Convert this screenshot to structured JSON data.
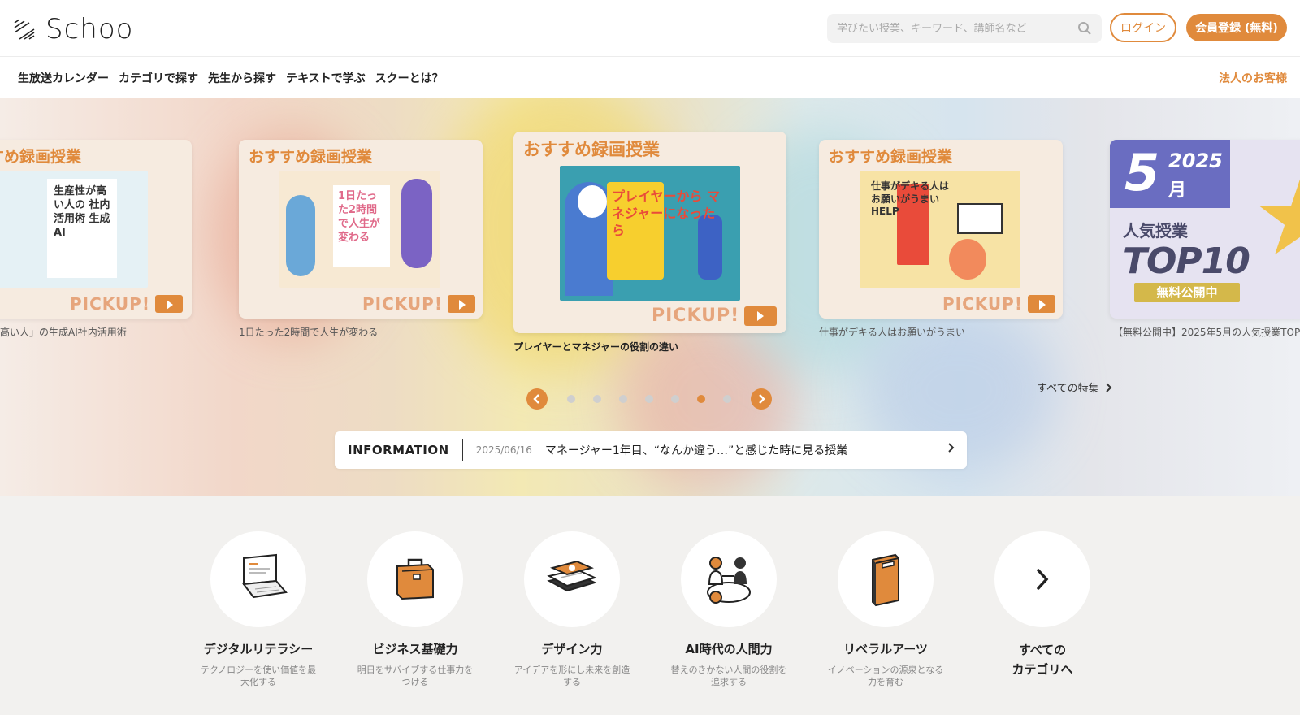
{
  "header": {
    "logo_text": "Schoo",
    "search_placeholder": "学びたい授業、キーワード、講師名など",
    "login_label": "ログイン",
    "register_label": "会員登録 (無料)"
  },
  "nav": {
    "items": [
      {
        "label": "生放送カレンダー"
      },
      {
        "label": "カテゴリで探す"
      },
      {
        "label": "先生から探す"
      },
      {
        "label": "テキストで学ぶ"
      },
      {
        "label": "スクーとは？"
      }
    ],
    "corporate_label": "法人のお客様"
  },
  "carousel": {
    "cards": [
      {
        "heading": "おすすめ録画授業",
        "art_text": "生産性が高い人の 社内活用術 生成AI",
        "pickup": "PICKUP!",
        "caption": "高い人」の生成AI社内活用術"
      },
      {
        "heading": "おすすめ録画授業",
        "art_text": "1日たった2時間で人生が変わる",
        "pickup": "PICKUP!",
        "caption": "1日たった2時間で人生が変わる"
      },
      {
        "heading": "おすすめ録画授業",
        "art_text": "プレイヤーから マネジャーになったら",
        "pickup": "PICKUP!",
        "caption": "プレイヤーとマネジャーの役割の違い"
      },
      {
        "heading": "おすすめ録画授業",
        "art_text": "仕事がデキる人は お願いがうまい HELP",
        "pickup": "PICKUP!",
        "caption": "仕事がデキる人はお願いがうまい"
      },
      {
        "month": "5",
        "month_unit": "月",
        "year": "2025",
        "line1": "人気授業",
        "line2": "TOP10",
        "badge": "無料公開中",
        "caption": "【無料公開中】2025年5月の人気授業TOP"
      }
    ],
    "all_features_label": "すべての特集",
    "dot_count": 7,
    "active_dot": 6,
    "prev_icon": "chevron-left-icon",
    "next_icon": "chevron-right-icon"
  },
  "info": {
    "label": "INFORMATION",
    "date": "2025/06/16",
    "text": "マネージャー1年目、“なんか違う…”と感じた時に見る授業"
  },
  "categories": [
    {
      "title": "デジタルリテラシー",
      "desc": "テクノロジーを使い価値を最大化する",
      "icon": "laptop-icon"
    },
    {
      "title": "ビジネス基礎力",
      "desc": "明日をサバイブする仕事力をつける",
      "icon": "briefcase-icon"
    },
    {
      "title": "デザイン力",
      "desc": "アイデアを形にし未来を創造する",
      "icon": "design-tools-icon"
    },
    {
      "title": "AI時代の人間力",
      "desc": "替えのきかない人間の役割を追求する",
      "icon": "people-icon"
    },
    {
      "title": "リベラルアーツ",
      "desc": "イノベーションの源泉となる力を育む",
      "icon": "book-icon"
    },
    {
      "title": "すべての\nカテゴリへ",
      "desc": "",
      "icon": "chevron-right-icon"
    }
  ],
  "colors": {
    "accent": "#e08a3c",
    "category_bg": "#f2f1ef"
  }
}
